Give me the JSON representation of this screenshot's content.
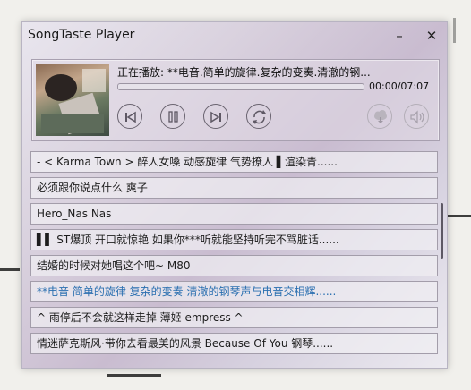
{
  "window": {
    "title": "SongTaste Player",
    "minimize_label": "–",
    "close_label": "✕"
  },
  "player": {
    "now_playing": "正在播放: **电音.简单的旋律.复杂的变奏.清澈的钢...",
    "time": "00:00/07:07",
    "progress_fraction": 0,
    "controls": [
      {
        "name": "previous-icon"
      },
      {
        "name": "pause-icon"
      },
      {
        "name": "next-icon"
      },
      {
        "name": "repeat-icon"
      },
      {
        "name": "download-icon"
      },
      {
        "name": "volume-icon"
      }
    ]
  },
  "playlist": {
    "items": [
      {
        "title": "-  < Karma Town >  醉人女嗓 动感旋律 气势撩人 ▌渲染青......"
      },
      {
        "title": "必须跟你说点什么 爽子"
      },
      {
        "title": "Hero_Nas Nas"
      },
      {
        "title": "▌▌ ST爆顶 开口就惊艳 如果你***听就能坚持听完不骂脏话......"
      },
      {
        "title": "结婚的时候对她唱这个吧~ M80"
      },
      {
        "title": "**电音 简单的旋律 复杂的变奏 清澈的钢琴声与电音交相辉......",
        "current": true
      },
      {
        "title": "^ 雨停后不会就这样走掉 薄姬 empress ^"
      },
      {
        "title": "情迷萨克斯风·带你去看最美的风景 Because Of You 钢琴......"
      }
    ],
    "accent_color": "#2a6fb0"
  }
}
